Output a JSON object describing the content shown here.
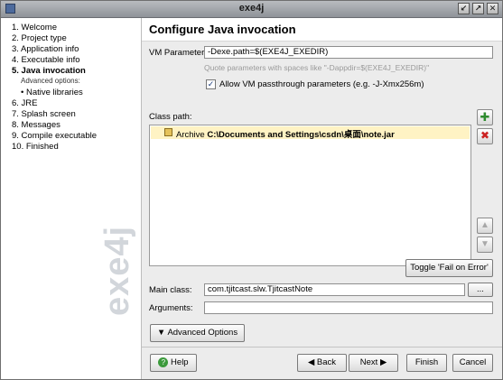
{
  "window": {
    "title": "exe4j"
  },
  "title_buttons": {
    "minimize": "↙",
    "maximize": "↗",
    "close": "✕"
  },
  "sidebar": {
    "steps": [
      {
        "label": "1. Welcome"
      },
      {
        "label": "2. Project type"
      },
      {
        "label": "3. Application info"
      },
      {
        "label": "4. Executable info"
      },
      {
        "label": "5. Java invocation",
        "active": true
      },
      {
        "label": "Advanced options:"
      },
      {
        "label": "• Native libraries"
      },
      {
        "label": "6. JRE"
      },
      {
        "label": "7. Splash screen"
      },
      {
        "label": "8. Messages"
      },
      {
        "label": "9. Compile executable"
      },
      {
        "label": "10. Finished"
      }
    ],
    "watermark": "exe4j"
  },
  "header": {
    "title": "Configure Java invocation"
  },
  "vm": {
    "label": "VM Parameters:",
    "value": "-Dexe.path=$(EXE4J_EXEDIR)",
    "hint": "Quote parameters with spaces like \"-Dappdir=$(EXE4J_EXEDIR)\"",
    "passthrough_label": "Allow VM passthrough parameters (e.g. -J-Xmx256m)",
    "passthrough_checked": true
  },
  "classpath": {
    "label": "Class path:",
    "entries": [
      {
        "type": "Archive",
        "path": "C:\\Documents and Settings\\csdn\\桌面\\note.jar"
      }
    ],
    "add_glyph": "✚",
    "remove_glyph": "✖",
    "up_glyph": "▲",
    "down_glyph": "▼",
    "toggle_label": "Toggle 'Fail on Error'"
  },
  "main_class": {
    "label": "Main class:",
    "value": "com.tjitcast.slw.TjitcastNote",
    "browse_label": "..."
  },
  "arguments": {
    "label": "Arguments:",
    "value": ""
  },
  "advanced": {
    "label": "Advanced Options",
    "arrow": "▼"
  },
  "footer": {
    "help": "Help",
    "help_glyph": "?",
    "back": "Back",
    "back_glyph": "◀",
    "next": "Next",
    "next_glyph": "▶",
    "finish": "Finish",
    "cancel": "Cancel"
  }
}
